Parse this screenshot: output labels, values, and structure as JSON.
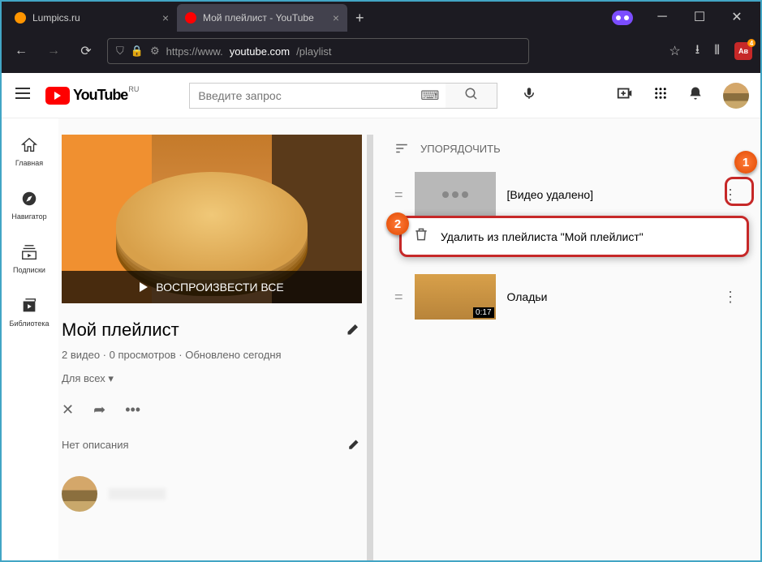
{
  "browser": {
    "tabs": [
      {
        "title": "Lumpics.ru"
      },
      {
        "title": "Мой плейлист - YouTube"
      }
    ],
    "url_prefix": "https://www.",
    "url_domain": "youtube.com",
    "url_path": "/playlist"
  },
  "yt": {
    "country": "RU",
    "brand": "YouTube",
    "search_placeholder": "Введите запрос",
    "sidebar": {
      "home": "Главная",
      "explore": "Навигатор",
      "subs": "Подписки",
      "library": "Библиотека"
    }
  },
  "playlist": {
    "play_all": "ВОСПРОИЗВЕСТИ ВСЕ",
    "title": "Мой плейлист",
    "meta": "2 видео · 0 просмотров · Обновлено сегодня",
    "visibility": "Для всех ▾",
    "no_desc": "Нет описания",
    "sort": "УПОРЯДОЧИТЬ",
    "items": [
      {
        "title": "[Видео удалено]",
        "duration": ""
      },
      {
        "title": "Оладьи",
        "duration": "0:17"
      }
    ],
    "menu_remove": "Удалить из плейлиста \"Мой плейлист\""
  },
  "callouts": {
    "one": "1",
    "two": "2"
  }
}
